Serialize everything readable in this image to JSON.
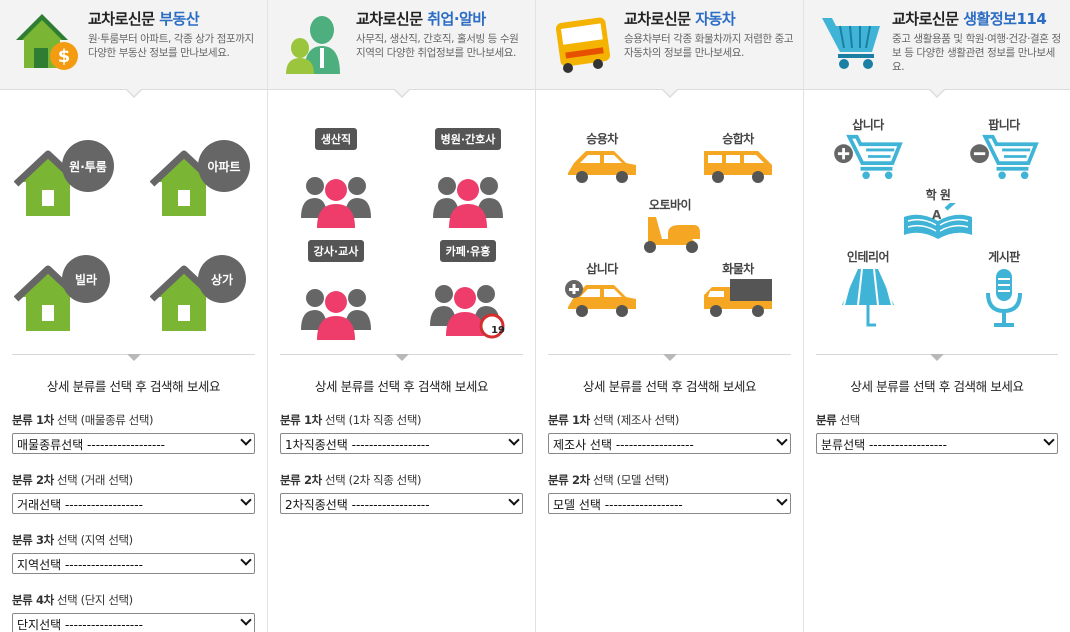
{
  "columns": [
    {
      "title_prefix": "교차로신문",
      "title_highlight": "부동산",
      "desc": "원·투룸부터 아파트, 각종 상가 점포까지 다양한 부동산 정보를 만나보세요.",
      "icon": "house-dollar-icon",
      "items": [
        {
          "label": "원·투룸",
          "icon": "house-icon"
        },
        {
          "label": "아파트",
          "icon": "house-icon"
        },
        {
          "label": "빌라",
          "icon": "house-icon"
        },
        {
          "label": "상가",
          "icon": "house-icon"
        }
      ],
      "guide": "상세 분류를 선택 후 검색해 보세요",
      "fields": [
        {
          "label_a": "분류 1차",
          "label_b": " 선택 (매물종류 선택)",
          "value": "매물종류선택 ------------------"
        },
        {
          "label_a": "분류 2차",
          "label_b": " 선택 (거래 선택)",
          "value": "거래선택 ------------------"
        },
        {
          "label_a": "분류 3차",
          "label_b": " 선택 (지역 선택)",
          "value": "지역선택 ------------------"
        },
        {
          "label_a": "분류 4차",
          "label_b": " 선택 (단지 선택)",
          "value": "단지선택 ------------------"
        }
      ]
    },
    {
      "title_prefix": "교차로신문",
      "title_highlight": "취업·알바",
      "desc": "사무직, 생산직, 간호직, 홀서빙 등 수원지역의 다양한 취업정보를 만나보세요.",
      "icon": "people-icon",
      "items": [
        {
          "label": "생산직",
          "icon": "people-group-icon"
        },
        {
          "label": "병원·간호사",
          "icon": "people-group-icon"
        },
        {
          "label": "강사·교사",
          "icon": "people-group-icon"
        },
        {
          "label": "카페·유흥",
          "icon": "people-group-icon",
          "badge": "19"
        }
      ],
      "guide": "상세 분류를 선택 후 검색해 보세요",
      "fields": [
        {
          "label_a": "분류 1차",
          "label_b": " 선택 (1차 직종 선택)",
          "value": "1차직종선택 ------------------"
        },
        {
          "label_a": "분류 2차",
          "label_b": " 선택 (2차 직종 선택)",
          "value": "2차직종선택 ------------------"
        }
      ]
    },
    {
      "title_prefix": "교차로신문",
      "title_highlight": "자동차",
      "desc": "승용차부터 각종 화물차까지 저렴한 중고 자동차의 정보를 만나보세요.",
      "icon": "bus-icon",
      "items": [
        {
          "label": "승용차",
          "icon": "car-icon"
        },
        {
          "label": "승합차",
          "icon": "van-icon"
        },
        {
          "label": "오토바이",
          "icon": "scooter-icon"
        },
        {
          "label": "삽니다",
          "icon": "car-plus-icon"
        },
        {
          "label": "화물차",
          "icon": "truck-icon"
        }
      ],
      "guide": "상세 분류를 선택 후 검색해 보세요",
      "fields": [
        {
          "label_a": "분류 1차",
          "label_b": " 선택 (제조사 선택)",
          "value": "제조사 선택 ------------------"
        },
        {
          "label_a": "분류 2차",
          "label_b": " 선택 (모델 선택)",
          "value": "모델 선택 ------------------"
        }
      ]
    },
    {
      "title_prefix": "교차로신문",
      "title_highlight": "생활정보114",
      "desc": "중고 생활용품 및 학원·여행·건강·결혼 정보 등 다양한 생활관련 정보를 만나보세요.",
      "icon": "cart-icon",
      "items": [
        {
          "label": "삽니다",
          "icon": "cart-plus-icon"
        },
        {
          "label": "팝니다",
          "icon": "cart-minus-icon"
        },
        {
          "label": "학 원",
          "icon": "book-icon"
        },
        {
          "label": "인테리어",
          "icon": "lamp-icon"
        },
        {
          "label": "게시판",
          "icon": "microphone-icon"
        }
      ],
      "guide": "상세 분류를 선택 후 검색해 보세요",
      "fields": [
        {
          "label_a": "분류",
          "label_b": " 선택",
          "value": "분류선택 ------------------"
        }
      ]
    }
  ],
  "colors": {
    "accent_blue": "#2b6cc4",
    "house_green": "#7ab534",
    "roof_gray": "#666666",
    "person_pink": "#ee3d6b",
    "car_orange": "#f5a623",
    "cart_teal": "#3fb4d6"
  }
}
